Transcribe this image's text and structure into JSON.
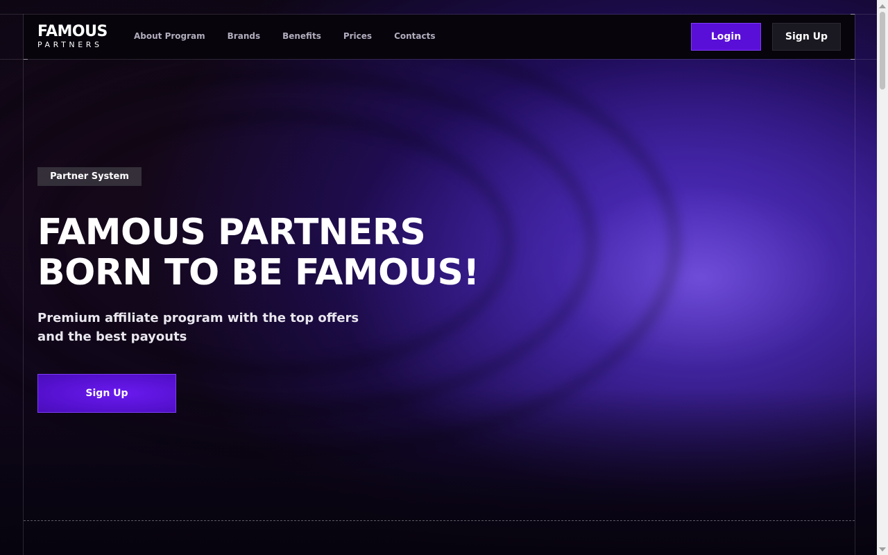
{
  "header": {
    "logo": {
      "line1": "FAMOUS",
      "line2": "PARTNERS"
    },
    "nav": [
      {
        "label": "About Program"
      },
      {
        "label": "Brands"
      },
      {
        "label": "Benefits"
      },
      {
        "label": "Prices"
      },
      {
        "label": "Contacts"
      }
    ],
    "login_label": "Login",
    "signup_label": "Sign Up"
  },
  "hero": {
    "badge": "Partner System",
    "title_line1": "FAMOUS PARTNERS",
    "title_line2": "BORN TO BE FAMOUS!",
    "subtitle_line1": "Premium affiliate program with the top offers",
    "subtitle_line2": "and the best payouts",
    "cta_label": "Sign Up"
  },
  "colors": {
    "accent": "#5a0fd8",
    "background": "#080410"
  }
}
